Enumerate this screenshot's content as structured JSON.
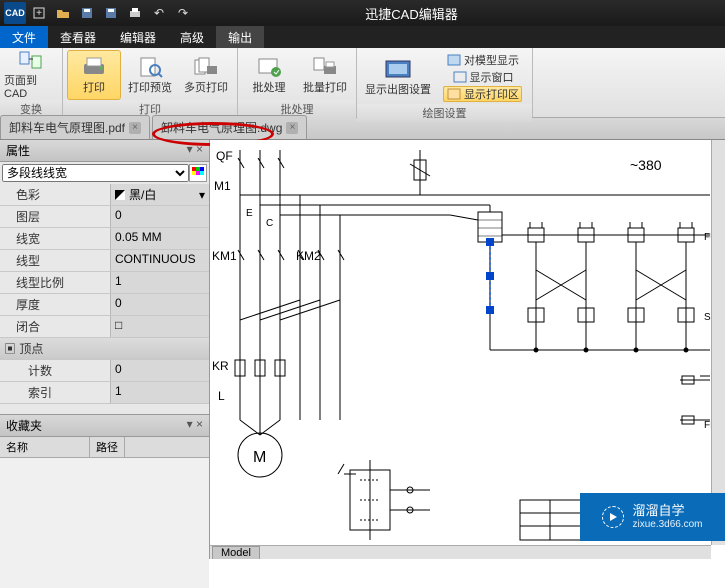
{
  "app": {
    "title": "迅捷CAD编辑器"
  },
  "menu": {
    "file": "文件",
    "tabs": [
      "查看器",
      "编辑器",
      "高级",
      "输出"
    ],
    "active": "输出"
  },
  "ribbon": {
    "groups": [
      {
        "label": "变换",
        "buttons": [
          {
            "id": "page-to-cad",
            "text": "页面到 CAD"
          }
        ]
      },
      {
        "label": "打印",
        "buttons": [
          {
            "id": "print",
            "text": "打印",
            "active": true
          },
          {
            "id": "print-preview",
            "text": "打印预览"
          },
          {
            "id": "multi-print",
            "text": "多页打印"
          }
        ]
      },
      {
        "label": "批处理",
        "buttons": [
          {
            "id": "batch",
            "text": "批处理"
          },
          {
            "id": "batch-print",
            "text": "批量打印"
          }
        ]
      },
      {
        "label": "绘图设置",
        "buttons": [
          {
            "id": "plot-settings",
            "text": "显示出图设置"
          }
        ]
      }
    ],
    "side": {
      "model_display": "对模型显示",
      "show_window": "显示窗口",
      "show_plot_area": "显示打印区"
    }
  },
  "doctabs": [
    {
      "name": "卸料车电气原理图.pdf",
      "closable": true
    },
    {
      "name": "卸料车电气原理图.dwg",
      "closable": true,
      "highlight": true
    }
  ],
  "properties": {
    "title": "属性",
    "selector": "多段线线宽",
    "color_label": "色彩",
    "color_value": "黑/白",
    "rows": [
      {
        "lab": "图层",
        "val": "0"
      },
      {
        "lab": "线宽",
        "val": "0.05 MM"
      },
      {
        "lab": "线型",
        "val": "CONTINUOUS"
      },
      {
        "lab": "线型比例",
        "val": "1"
      },
      {
        "lab": "厚度",
        "val": "0"
      },
      {
        "lab": "闭合",
        "val": "□"
      }
    ],
    "vertex_header": "顶点",
    "vertex_rows": [
      {
        "lab": "计数",
        "val": "0"
      },
      {
        "lab": "索引",
        "val": "1"
      }
    ],
    "favorites": {
      "title": "收藏夹",
      "cols": [
        "名称",
        "路径"
      ]
    }
  },
  "canvas": {
    "labels": {
      "qf": "QF",
      "m1": "M1",
      "km1": "KM1",
      "km2": "KM2",
      "kr": "KR",
      "m": "M",
      "l": "L",
      "e": "E",
      "c": "C",
      "v380": "~380",
      "fu": "FU",
      "fu2": "FH",
      "sb": "SB"
    },
    "model_tab": "Model"
  },
  "brand": {
    "name": "溜溜自学",
    "url": "zixue.3d66.com"
  }
}
